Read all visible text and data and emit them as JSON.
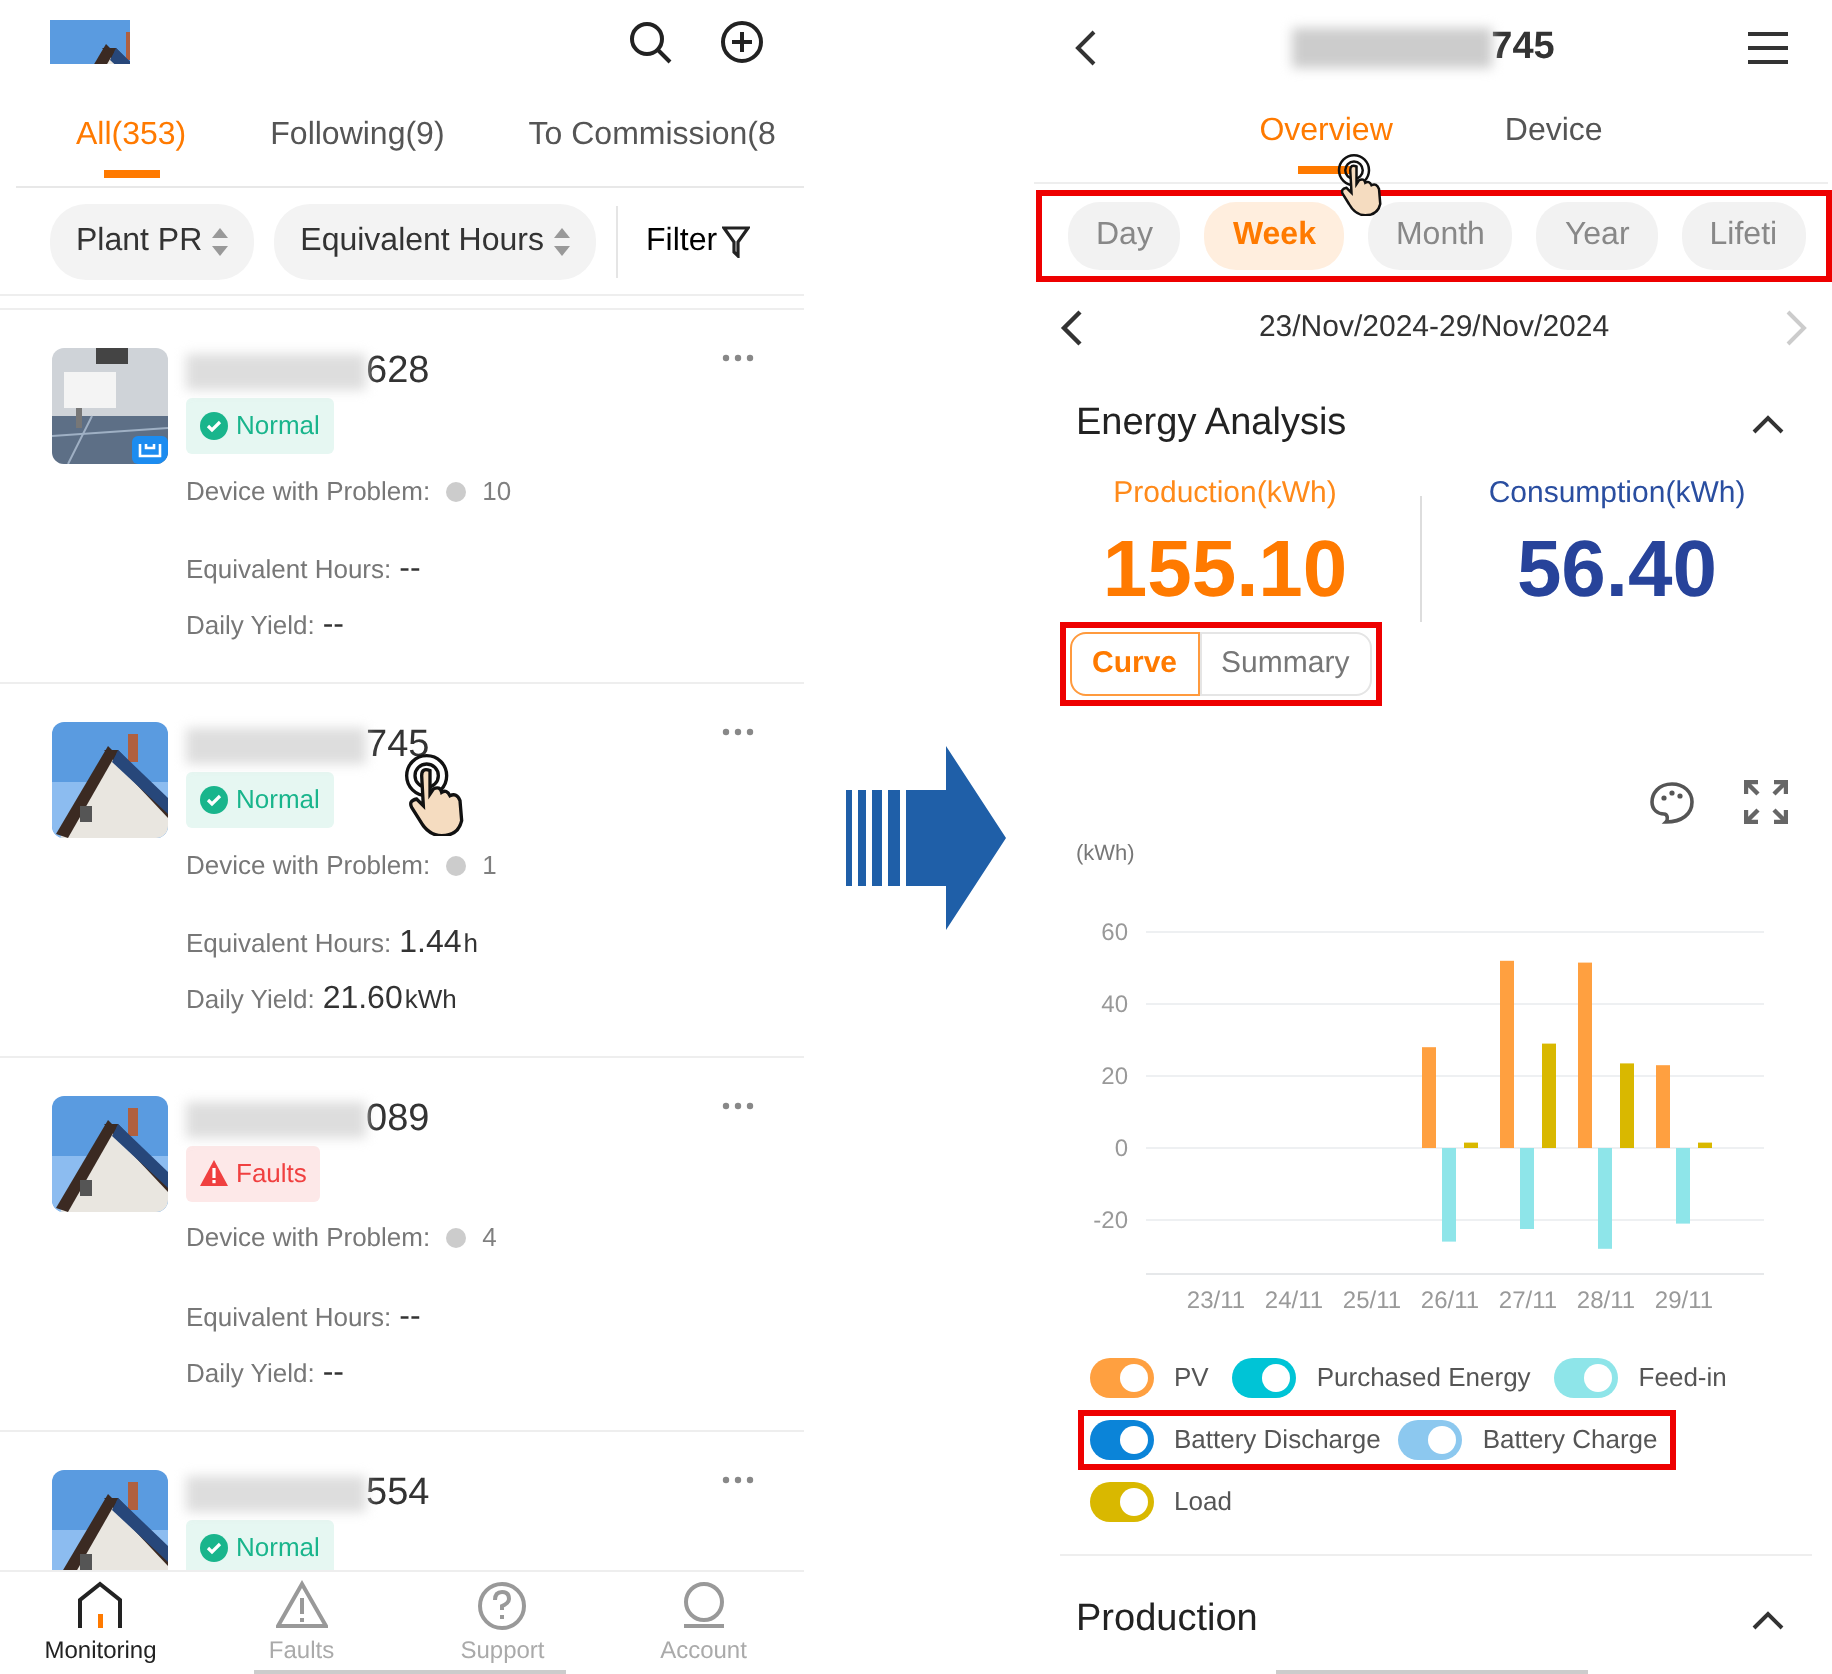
{
  "plant_list_screen": {
    "tabs": [
      {
        "label": "All(353)",
        "selected": true
      },
      {
        "label": "Following(9)",
        "selected": false
      },
      {
        "label": "To Commission(8",
        "selected": false
      }
    ],
    "sort_chips": [
      {
        "label": "Plant PR"
      },
      {
        "label": "Equivalent Hours"
      }
    ],
    "filter_label": "Filter",
    "plants": [
      {
        "name_visible": "628",
        "thumbnail_badge": true,
        "tap_gesture": false,
        "status": {
          "kind": "normal",
          "label": "Normal"
        },
        "problem_label": "Device with Problem:",
        "problem_count": "10",
        "hours_label": "Equivalent Hours:",
        "hours_value": "--",
        "yield_label": "Daily Yield:",
        "yield_value": "--"
      },
      {
        "name_visible": "745",
        "thumbnail_badge": false,
        "tap_gesture": true,
        "status": {
          "kind": "normal",
          "label": "Normal"
        },
        "problem_label": "Device with Problem:",
        "problem_count": "1",
        "hours_label": "Equivalent Hours:",
        "hours_value": "1.44",
        "hours_unit": "h",
        "yield_label": "Daily Yield:",
        "yield_value": "21.60",
        "yield_unit": "kWh"
      },
      {
        "name_visible": "089",
        "thumbnail_badge": false,
        "tap_gesture": false,
        "status": {
          "kind": "faults",
          "label": "Faults"
        },
        "problem_label": "Device with Problem:",
        "problem_count": "4",
        "hours_label": "Equivalent Hours:",
        "hours_value": "--",
        "yield_label": "Daily Yield:",
        "yield_value": "--"
      },
      {
        "name_visible": "554",
        "thumbnail_badge": false,
        "tap_gesture": false,
        "status": {
          "kind": "normal",
          "label": "Normal"
        }
      }
    ],
    "bottom_nav": [
      {
        "kind": "monitoring",
        "label": "Monitoring",
        "selected": true
      },
      {
        "kind": "faults",
        "label": "Faults",
        "selected": false
      },
      {
        "kind": "support",
        "label": "Support",
        "selected": false
      },
      {
        "kind": "account",
        "label": "Account",
        "selected": false
      }
    ]
  },
  "plant_detail_screen": {
    "title_visible": "745",
    "tabs": [
      {
        "label": "Overview",
        "selected": true,
        "tap_gesture": true
      },
      {
        "label": "Device",
        "selected": false,
        "tap_gesture": false
      }
    ],
    "period_chips": {
      "highlighted": true,
      "items": [
        {
          "label": "Day",
          "selected": false
        },
        {
          "label": "Week",
          "selected": true
        },
        {
          "label": "Month",
          "selected": false
        },
        {
          "label": "Year",
          "selected": false
        },
        {
          "label": "Lifeti",
          "selected": false
        }
      ]
    },
    "date_range": "23/Nov/2024-29/Nov/2024",
    "next_disabled": true,
    "energy_analysis": {
      "title": "Energy Analysis",
      "production_label": "Production(kWh)",
      "production_value": "155.10",
      "consumption_label": "Consumption(kWh)",
      "consumption_value": "56.40",
      "view_toggle": {
        "highlighted": true,
        "items": [
          {
            "label": "Curve",
            "selected": true
          },
          {
            "label": "Summary",
            "selected": false
          }
        ]
      },
      "chart_data": {
        "type": "bar",
        "ylabel": "(kWh)",
        "categories": [
          "23/11",
          "24/11",
          "25/11",
          "26/11",
          "27/11",
          "28/11",
          "29/11"
        ],
        "series": [
          {
            "name": "PV",
            "color": "#ffa040",
            "values": [
              null,
              null,
              null,
              28,
              52,
              51.5,
              23
            ]
          },
          {
            "name": "Purchased Energy",
            "color": "#00c4d6",
            "values": [
              null,
              null,
              null,
              null,
              null,
              null,
              null
            ]
          },
          {
            "name": "Feed-in",
            "color": "#8ee5e9",
            "values": [
              null,
              null,
              null,
              -26,
              -22.5,
              -28,
              -21
            ]
          },
          {
            "name": "Battery Discharge",
            "color": "#0b84d8",
            "values": [
              null,
              null,
              null,
              null,
              null,
              null,
              null
            ]
          },
          {
            "name": "Battery Charge",
            "color": "#8cc8ef",
            "values": [
              null,
              null,
              null,
              null,
              null,
              null,
              null
            ]
          },
          {
            "name": "Load",
            "color": "#d9b800",
            "values": [
              null,
              null,
              null,
              1.5,
              29,
              23.5,
              1.5
            ]
          }
        ],
        "grid": true,
        "ylim": [
          -35,
          60
        ],
        "yticks": [
          -20,
          0,
          20,
          40,
          60
        ]
      },
      "legend_toggles": [
        {
          "on": true,
          "highlighted": false
        },
        {
          "on": true,
          "highlighted": false
        },
        {
          "on": true,
          "highlighted": false
        },
        {
          "on": true,
          "highlighted": true
        },
        {
          "on": true,
          "highlighted": true
        },
        {
          "on": true,
          "highlighted": false
        }
      ]
    },
    "next_section_title": "Production"
  }
}
